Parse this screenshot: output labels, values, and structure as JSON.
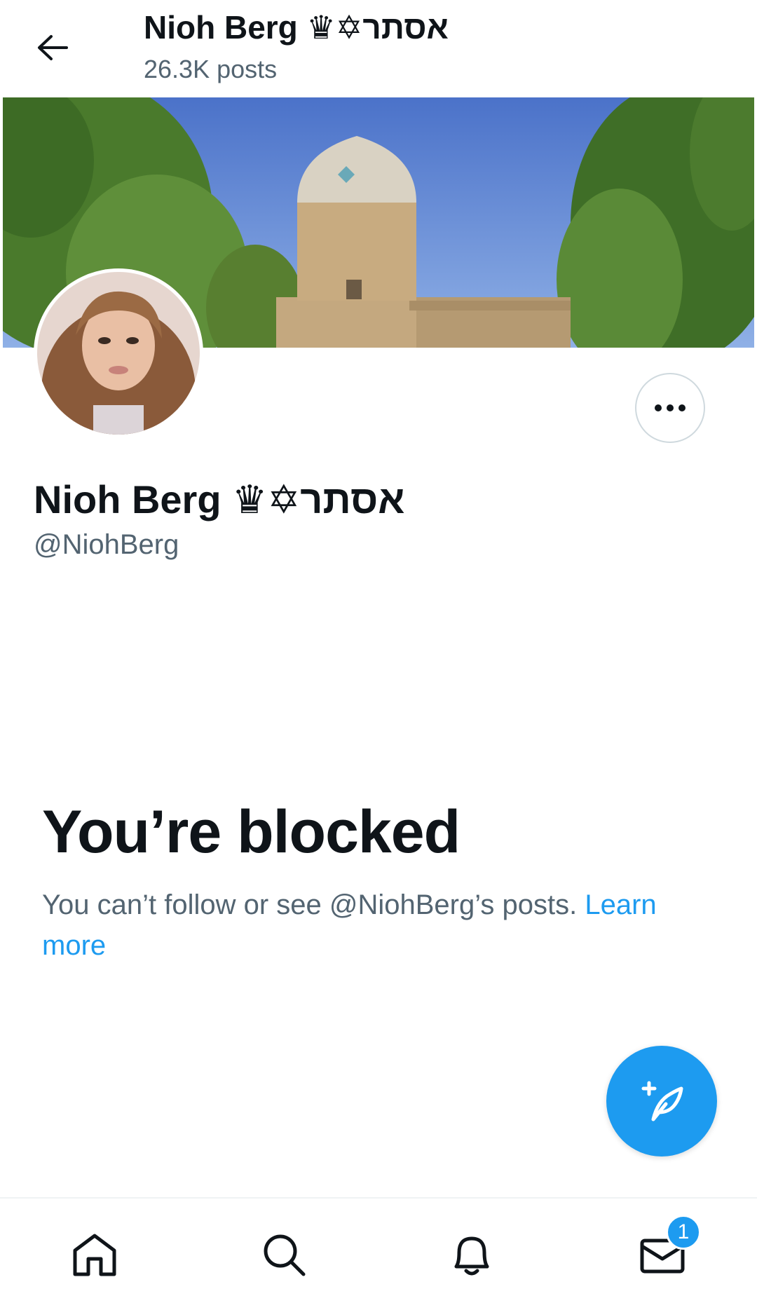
{
  "header": {
    "title": "Nioh Berg ♛✡אסתר",
    "posts_count": "26.3K posts"
  },
  "profile": {
    "display_name": "Nioh Berg ♛✡אסתר",
    "handle": "@NiohBerg"
  },
  "blocked": {
    "title": "You’re blocked",
    "message": "You can’t follow or see @NiohBerg’s posts. ",
    "link_label": "Learn more"
  },
  "bottom_nav": {
    "items": [
      "home-icon",
      "search-icon",
      "notifications-icon",
      "messages-icon"
    ],
    "messages_badge": "1"
  },
  "colors": {
    "accent": "#1d9bf0",
    "secondary_text": "#536471",
    "primary_text": "#0f1419"
  }
}
